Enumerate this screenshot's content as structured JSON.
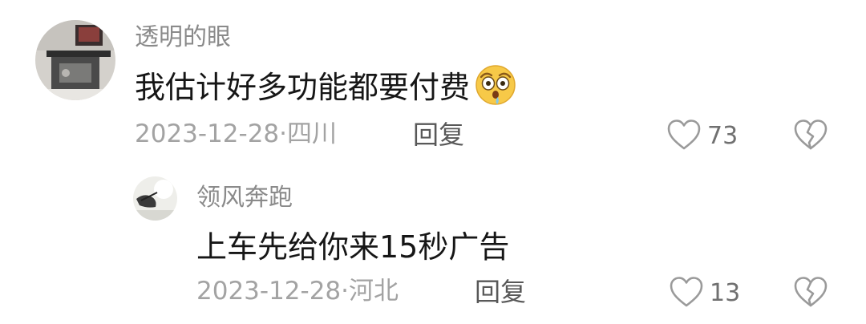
{
  "comments": [
    {
      "username": "透明的眼",
      "content": "我估计好多功能都要付费",
      "emoji": "emoji-shocked-drooling",
      "date": "2023-12-28",
      "separator": "·",
      "location": "四川",
      "reply_label": "回复",
      "likes": "73"
    }
  ],
  "replies": [
    {
      "username": "领风奔跑",
      "content": "上车先给你来15秒广告",
      "date": "2023-12-28",
      "separator": "·",
      "location": "河北",
      "reply_label": "回复",
      "likes": "13"
    }
  ],
  "icons": {
    "like": "heart-outline-icon",
    "dislike": "broken-heart-outline-icon"
  },
  "colors": {
    "username": "#8a8a8a",
    "content": "#161616",
    "meta": "#a3a3a3",
    "reply": "#585858",
    "icon": "#9a9a9a"
  }
}
